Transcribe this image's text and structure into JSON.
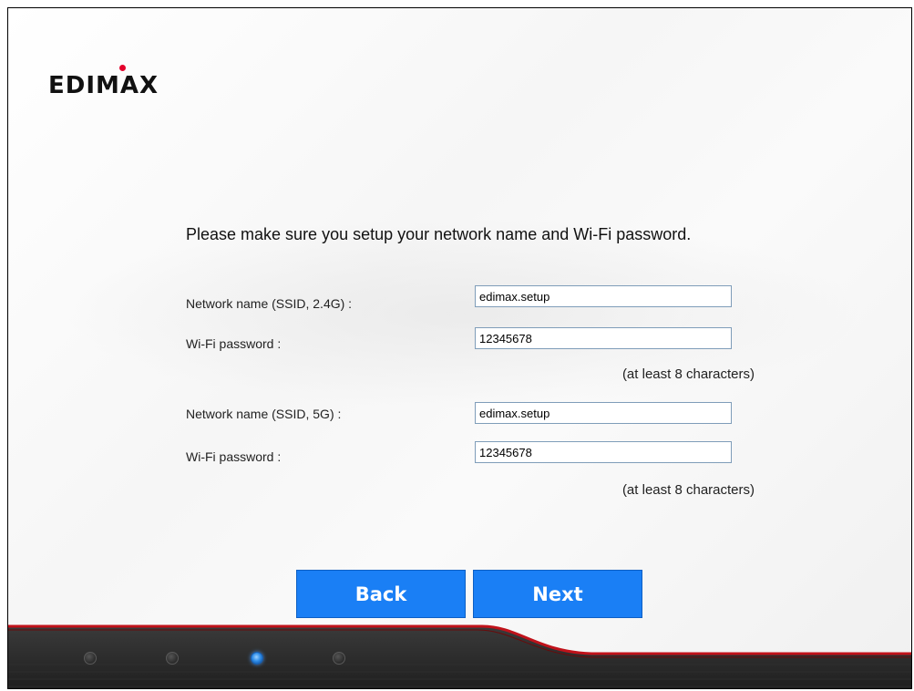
{
  "brand": {
    "logo_text": "EDIMAX"
  },
  "form": {
    "heading": "Please make sure you setup your network name and Wi-Fi password.",
    "ssid_24_label": "Network name (SSID, 2.4G) :",
    "ssid_24_value": "edimax.setup",
    "password_24_label": "Wi-Fi password :",
    "password_24_value": "12345678",
    "hint_24": "(at least 8 characters)",
    "ssid_5_label": "Network name (SSID, 5G) :",
    "ssid_5_value": "edimax.setup",
    "password_5_label": "Wi-Fi password :",
    "password_5_value": "12345678",
    "hint_5": "(at least 8 characters)"
  },
  "buttons": {
    "back_label": "Back",
    "next_label": "Next"
  },
  "progress": {
    "total_steps": 4,
    "current_step": 3
  },
  "colors": {
    "accent": "#1a7ff5",
    "brand_red": "#e4002b",
    "footer": "#2a2a2a"
  }
}
